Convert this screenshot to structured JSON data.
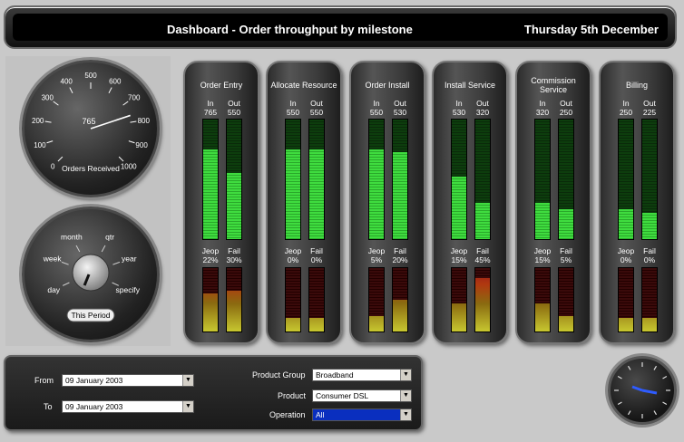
{
  "header": {
    "title": "Dashboard - Order throughput by milestone",
    "date": "Thursday 5th December"
  },
  "orders_gauge": {
    "ticks": [
      "0",
      "100",
      "200",
      "300",
      "400",
      "500",
      "600",
      "700",
      "800",
      "900",
      "1000"
    ],
    "value": "765",
    "label": "Orders Received"
  },
  "period_selector": {
    "options": [
      "day",
      "week",
      "month",
      "qtr",
      "year",
      "specify"
    ],
    "button": "This Period"
  },
  "column_labels": {
    "in": "In",
    "out": "Out",
    "jeop": "Jeop",
    "fail": "Fail"
  },
  "stages": [
    {
      "name": "Order Entry",
      "in": "765",
      "out": "550",
      "jeop": "22%",
      "fail": "30%",
      "in_level": 0.75,
      "out_level": 0.55,
      "jeop_level": 0.6,
      "fail_level": 0.65
    },
    {
      "name": "Allocate Resource",
      "in": "550",
      "out": "550",
      "jeop": "0%",
      "fail": "0%",
      "in_level": 0.75,
      "out_level": 0.75,
      "jeop_level": 0.0,
      "fail_level": 0.0
    },
    {
      "name": "Order Install",
      "in": "550",
      "out": "530",
      "jeop": "5%",
      "fail": "20%",
      "in_level": 0.75,
      "out_level": 0.73,
      "jeop_level": 0.25,
      "fail_level": 0.5
    },
    {
      "name": "Install Service",
      "in": "530",
      "out": "320",
      "jeop": "15%",
      "fail": "45%",
      "in_level": 0.52,
      "out_level": 0.3,
      "jeop_level": 0.45,
      "fail_level": 0.85
    },
    {
      "name": "Commission Service",
      "in": "320",
      "out": "250",
      "jeop": "15%",
      "fail": "5%",
      "in_level": 0.3,
      "out_level": 0.25,
      "jeop_level": 0.45,
      "fail_level": 0.25
    },
    {
      "name": "Billing",
      "in": "250",
      "out": "225",
      "jeop": "0%",
      "fail": "0%",
      "in_level": 0.25,
      "out_level": 0.22,
      "jeop_level": 0.0,
      "fail_level": 0.0
    }
  ],
  "filters": {
    "from_label": "From",
    "from_value": "09   January   2003",
    "to_label": "To",
    "to_value": "09   January   2003",
    "product_group_label": "Product Group",
    "product_group_value": "Broadband",
    "product_label": "Product",
    "product_value": "Consumer DSL",
    "operation_label": "Operation",
    "operation_value": "All"
  },
  "colors": {
    "bar_green": "#3fdc3f",
    "bar_red": "#9a1818",
    "bar_yellow": "#c8c830",
    "selection_blue": "#0a2fbf"
  }
}
